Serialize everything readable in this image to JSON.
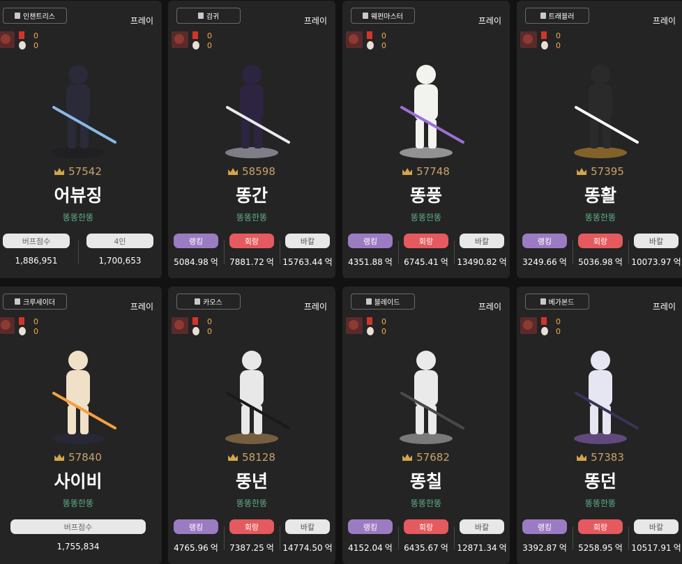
{
  "labels": {
    "play": "프레이",
    "unit": "억",
    "guild": "똥똥한똥",
    "ranking": "랭킹",
    "rotation": "회랑",
    "bakal": "바칼",
    "buff_score": "버프점수",
    "four_person": "4인"
  },
  "colors": {
    "card_bg": "#242424",
    "ranking": "#9b7cc2",
    "rotation": "#e45a5e",
    "bakal": "#e8e8e8",
    "guild": "#5fae87",
    "score": "#c8a36b"
  },
  "cards": [
    {
      "job": "인챈트리스",
      "medal_count": "0",
      "face_count": "0",
      "score": "57542",
      "name": "어뷰징",
      "type": "buffer",
      "buff_score": "1,886,951",
      "four_person_score": "1,700,653",
      "portrait": "enchantress-character-icon"
    },
    {
      "job": "검귀",
      "medal_count": "0",
      "face_count": "0",
      "score": "58598",
      "name": "똥간",
      "type": "dealer",
      "ranking": "5084.98",
      "rotation": "7881.72",
      "bakal": "15763.44",
      "portrait": "sword-demon-character-icon"
    },
    {
      "job": "웨펀마스터",
      "medal_count": "0",
      "face_count": "0",
      "score": "57748",
      "name": "똥풍",
      "type": "dealer",
      "ranking": "4351.88",
      "rotation": "6745.41",
      "bakal": "13490.82",
      "portrait": "weapon-master-character-icon"
    },
    {
      "job": "트래블러",
      "medal_count": "0",
      "face_count": "0",
      "score": "57395",
      "name": "똥활",
      "type": "dealer",
      "ranking": "3249.66",
      "rotation": "5036.98",
      "bakal": "10073.97",
      "portrait": "traveler-character-icon"
    },
    {
      "job": "크루세이더",
      "medal_count": "0",
      "face_count": "0",
      "score": "57840",
      "name": "사이비",
      "type": "buffer-single",
      "buff_score": "1,755,834",
      "portrait": "crusader-character-icon"
    },
    {
      "job": "카오스",
      "medal_count": "0",
      "face_count": "0",
      "score": "58128",
      "name": "뚱년",
      "type": "dealer",
      "ranking": "4765.96",
      "rotation": "7387.25",
      "bakal": "14774.50",
      "portrait": "chaos-character-icon"
    },
    {
      "job": "블레이드",
      "medal_count": "0",
      "face_count": "0",
      "score": "57682",
      "name": "똥칠",
      "type": "dealer",
      "ranking": "4152.04",
      "rotation": "6435.67",
      "bakal": "12871.34",
      "portrait": "blade-character-icon"
    },
    {
      "job": "베가본드",
      "medal_count": "0",
      "face_count": "0",
      "score": "57383",
      "name": "똥던",
      "type": "dealer",
      "ranking": "3392.87",
      "rotation": "5258.95",
      "bakal": "10517.91",
      "portrait": "vagabond-character-icon"
    }
  ]
}
